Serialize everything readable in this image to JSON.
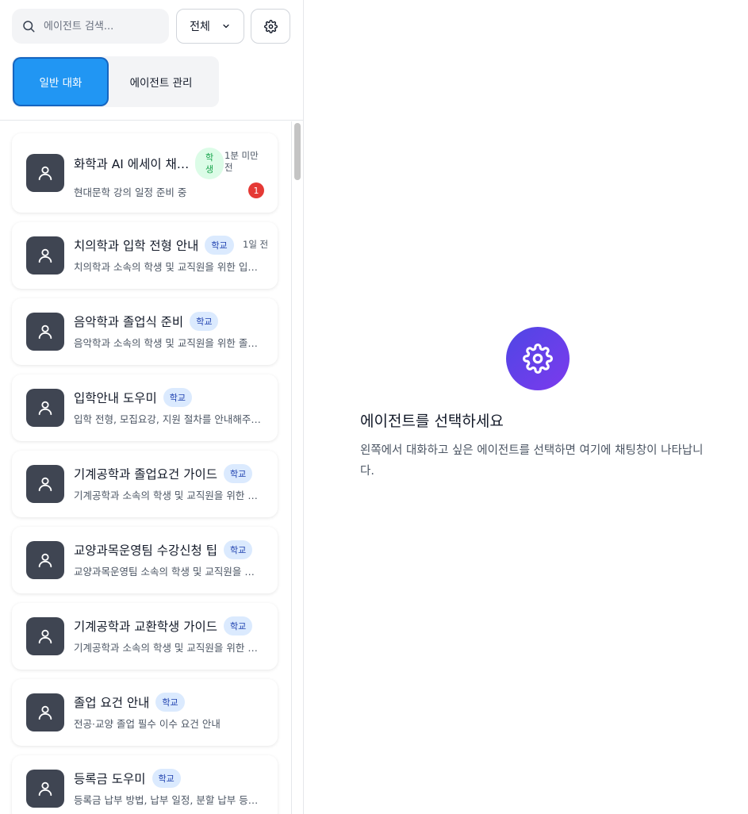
{
  "search": {
    "placeholder": "에이전트 검색..."
  },
  "filter": {
    "selected": "전체"
  },
  "tabs": [
    {
      "label": "일반 대화",
      "active": true
    },
    {
      "label": "에이전트 관리",
      "active": false
    }
  ],
  "agents": [
    {
      "name": "화학과 AI 에세이 채…",
      "badge": [
        "학",
        "생"
      ],
      "time": [
        "1분 미만",
        "전"
      ],
      "desc": "현대문학 강의 일정 준비 중",
      "unread": "1"
    },
    {
      "name": "치의학과 입학 전형 안내",
      "badge": "학교",
      "time": "1일 전",
      "desc": "치의학과 소속의 학생 및 교직원을 위한 입학 전형 안내"
    },
    {
      "name": "음악학과 졸업식 준비",
      "badge": "학교",
      "desc": "음악학과 소속의 학생 및 교직원을 위한 졸업식 준비"
    },
    {
      "name": "입학안내 도우미",
      "badge": "학교",
      "desc": "입학 전형, 모집요강, 지원 절차를 안내해주는 도우미"
    },
    {
      "name": "기계공학과 졸업요건 가이드",
      "badge": "학교",
      "desc": "기계공학과 소속의 학생 및 교직원을 위한 졸업요건 가이드"
    },
    {
      "name": "교양과목운영팀 수강신청 팁",
      "badge": "학교",
      "desc": "교양과목운영팀 소속의 학생 및 교직원을 위한 수강신청 팁"
    },
    {
      "name": "기계공학과 교환학생 가이드",
      "badge": "학교",
      "desc": "기계공학과 소속의 학생 및 교직원을 위한 교환학생 가이드"
    },
    {
      "name": "졸업 요건 안내",
      "badge": "학교",
      "desc": "전공·교양 졸업 필수 이수 요건 안내"
    },
    {
      "name": "등록금 도우미",
      "badge": "학교",
      "desc": "등록금 납부 방법, 납부 일정, 분할 납부 등을 안내"
    }
  ],
  "empty_state": {
    "icon": "gear-icon",
    "title": "에이전트를 선택하세요",
    "description": "왼쪽에서 대화하고 싶은 에이전트를 선택하면 여기에 채팅창이 나타납니다."
  },
  "colors": {
    "accent": "#2196f3",
    "avatar": "#3f4552",
    "badge_bg": "#dbeafe",
    "student_badge_bg": "#dcfce7",
    "unread": "#e53935"
  }
}
